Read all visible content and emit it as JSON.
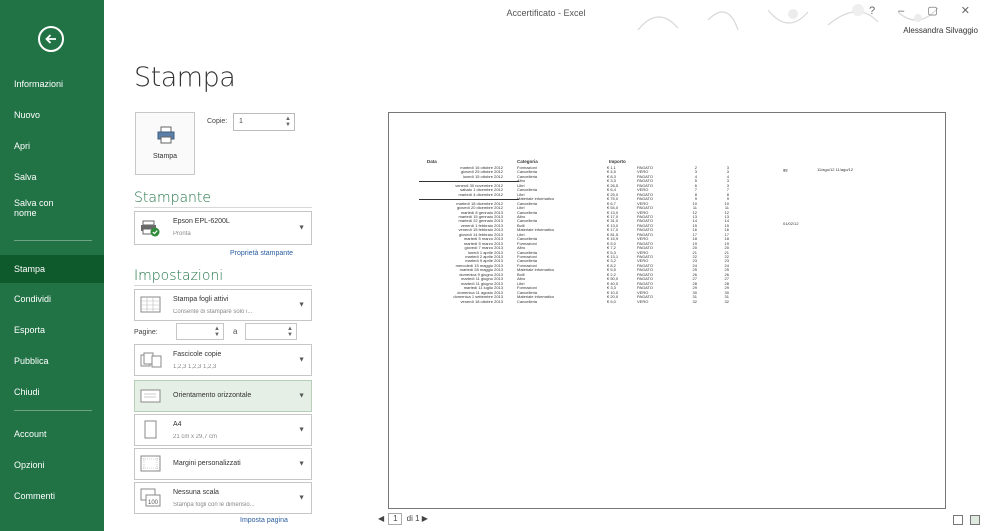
{
  "window": {
    "title": "Accertificato - Excel",
    "user": "Alessandra Silvaggio",
    "controls": [
      "?",
      "–",
      "▢",
      "✕"
    ]
  },
  "nav": {
    "back_icon": "back-arrow-icon",
    "items": [
      {
        "label": "Informazioni",
        "selected": false
      },
      {
        "label": "Nuovo",
        "selected": false
      },
      {
        "label": "Apri",
        "selected": false
      },
      {
        "label": "Salva",
        "selected": false
      },
      {
        "label": "Salva con nome",
        "selected": false
      },
      {
        "label": "Stampa",
        "selected": true
      },
      {
        "label": "Condividi",
        "selected": false
      },
      {
        "label": "Esporta",
        "selected": false
      },
      {
        "label": "Pubblica",
        "selected": false
      },
      {
        "label": "Chiudi",
        "selected": false
      },
      {
        "label": "Account",
        "selected": false
      },
      {
        "label": "Opzioni",
        "selected": false
      },
      {
        "label": "Commenti",
        "selected": false
      }
    ]
  },
  "print": {
    "heading": "Stampa",
    "print_button": "Stampa",
    "copies_label": "Copie:",
    "copies_value": "1"
  },
  "printer": {
    "section": "Stampante",
    "name": "Epson EPL-6200L",
    "status": "Pronta",
    "properties_link": "Proprietà stampante"
  },
  "settings": {
    "section": "Impostazioni",
    "what": {
      "title": "Stampa fogli attivi",
      "desc": "Consente di stampare solo i..."
    },
    "pages_label": "Pagine:",
    "pages_from": "",
    "pages_to": "",
    "collate": {
      "title": "Fascicole copie",
      "desc": "1,2,3   1,2,3   1,2,3"
    },
    "orientation": {
      "title": "Orientamento orizzontale",
      "desc": ""
    },
    "paper": {
      "title": "A4",
      "desc": "21 cm x 29,7 cm"
    },
    "margins": {
      "title": "Margini personalizzati",
      "desc": ""
    },
    "scaling": {
      "title": "Nessuna scala",
      "desc": "Stampa fogli con le dimensio..."
    },
    "page_setup_link": "Imposta pagina"
  },
  "preview": {
    "headers": {
      "date": "Data",
      "category": "Categoria",
      "amount": "Importo"
    },
    "rows": [
      {
        "date": "martedì 16 ottobre 2012",
        "cat": "Formazioni",
        "amt": "€ 1,1",
        "status": "PAGATO",
        "a": "2",
        "b": "3"
      },
      {
        "date": "giovedì 25 ottobre 2012",
        "cat": "Cancelleria",
        "amt": "€ 4,5",
        "status": "VERO",
        "a": "3",
        "b": "3"
      },
      {
        "date": "lunedì 15 ottobre 2012",
        "cat": "Cancelleria",
        "amt": "€ 8,3",
        "status": "PAGATO",
        "a": "4",
        "b": "4"
      },
      {
        "date": "",
        "cat": "Altro",
        "amt": "€ 3,3",
        "status": "PAGATO",
        "a": "5",
        "b": "3",
        "line": true
      },
      {
        "date": "venerdì 30 novembre 2012",
        "cat": "Libri",
        "amt": "€ 26,5",
        "status": "PAGATO",
        "a": "6",
        "b": "3"
      },
      {
        "date": "sabato 1 dicembre 2012",
        "cat": "Cancelleria",
        "amt": "€ 6,4",
        "status": "VERO",
        "a": "7",
        "b": "7"
      },
      {
        "date": "martedì 4 dicembre 2012",
        "cat": "Libri",
        "amt": "€ 25,0",
        "status": "PAGATO",
        "a": "8",
        "b": "8"
      },
      {
        "date": "",
        "cat": "Materiale informatico",
        "amt": "€ 75,0",
        "status": "PAGATO",
        "a": "9",
        "b": "9",
        "line": true
      },
      {
        "date": "martedì 18 dicembre 2012",
        "cat": "Cancelleria",
        "amt": "€ 6,7",
        "status": "VERO",
        "a": "10",
        "b": "10"
      },
      {
        "date": "giovedì 20 dicembre 2012",
        "cat": "Libri",
        "amt": "€ 54,0",
        "status": "PAGATO",
        "a": "11",
        "b": "11"
      },
      {
        "date": "martedì 8 gennaio 2013",
        "cat": "Cancelleria",
        "amt": "€ 13,0",
        "status": "VERO",
        "a": "12",
        "b": "12"
      },
      {
        "date": "martedì 15 gennaio 2013",
        "cat": "Altro",
        "amt": "€ 17,0",
        "status": "PAGATO",
        "a": "13",
        "b": "13"
      },
      {
        "date": "martedì 22 gennaio 2013",
        "cat": "Cancelleria",
        "amt": "€ 31,0",
        "status": "PAGATO",
        "a": "14",
        "b": "14"
      },
      {
        "date": "venerdì 1 febbraio 2013",
        "cat": "Bolli",
        "amt": "€ 13,0",
        "status": "PAGATO",
        "a": "15",
        "b": "15"
      },
      {
        "date": "venerdì 15 febbraio 2013",
        "cat": "Materiale informatico",
        "amt": "€ 17,0",
        "status": "PAGATO",
        "a": "16",
        "b": "16"
      },
      {
        "date": "giovedì 14 febbraio 2013",
        "cat": "Libri",
        "amt": "€ 81,5",
        "status": "PAGATO",
        "a": "17",
        "b": "17"
      },
      {
        "date": "martedì 5 marzo 2013",
        "cat": "Cancelleria",
        "amt": "€ 15,9",
        "status": "VERO",
        "a": "18",
        "b": "18"
      },
      {
        "date": "martedì 5 marzo 2013",
        "cat": "Formazioni",
        "amt": "€ 5,0",
        "status": "PAGATO",
        "a": "19",
        "b": "19"
      },
      {
        "date": "giovedì 7 marzo 2013",
        "cat": "Altro",
        "amt": "€ 7,2",
        "status": "PAGATO",
        "a": "20",
        "b": "20"
      },
      {
        "date": "lunedì 1 aprile 2013",
        "cat": "Cancelleria",
        "amt": "€ 5,3",
        "status": "VERO",
        "a": "21",
        "b": "21"
      },
      {
        "date": "martedì 2 aprile 2013",
        "cat": "Formazioni",
        "amt": "€ 13,1",
        "status": "PAGATO",
        "a": "22",
        "b": "22"
      },
      {
        "date": "martedì 9 aprile 2013",
        "cat": "Cancelleria",
        "amt": "€ 3,2",
        "status": "VERO",
        "a": "23",
        "b": "23"
      },
      {
        "date": "mercoledì 15 maggio 2013",
        "cat": "Formazioni",
        "amt": "€ 8,2",
        "status": "PAGATO",
        "a": "24",
        "b": "24"
      },
      {
        "date": "martedì 28 maggio 2013",
        "cat": "Materiale informatico",
        "amt": "€ 5,5",
        "status": "PAGATO",
        "a": "25",
        "b": "25"
      },
      {
        "date": "domenica 9 giugno 2013",
        "cat": "Bolli",
        "amt": "€ 2,2",
        "status": "PAGATO",
        "a": "26",
        "b": "26"
      },
      {
        "date": "martedì 11 giugno 2013",
        "cat": "Altro",
        "amt": "€ 50,0",
        "status": "PAGATO",
        "a": "27",
        "b": "27"
      },
      {
        "date": "martedì 11 giugno 2013",
        "cat": "Libri",
        "amt": "€ 40,0",
        "status": "PAGATO",
        "a": "28",
        "b": "28"
      },
      {
        "date": "martedì 11 luglio 2013",
        "cat": "Formazioni",
        "amt": "€ 3,3",
        "status": "PAGATO",
        "a": "29",
        "b": "29"
      },
      {
        "date": "domenica 11 agosto 2013",
        "cat": "Cancelleria",
        "amt": "€ 10,0",
        "status": "VERO",
        "a": "30",
        "b": "30"
      },
      {
        "date": "domenica 1 settembre 2013",
        "cat": "Materiale informatico",
        "amt": "€ 20,0",
        "status": "PAGATO",
        "a": "31",
        "b": "31"
      },
      {
        "date": "venerdì 18 ottobre 2013",
        "cat": "Cancelleria",
        "amt": "€ 5,0",
        "status": "VERO",
        "a": "32",
        "b": "32"
      }
    ],
    "side_texts": [
      "gg",
      "11/ago/12   11/ago/12",
      "01/02/12"
    ],
    "page_current": "1",
    "page_total": "di 1"
  }
}
